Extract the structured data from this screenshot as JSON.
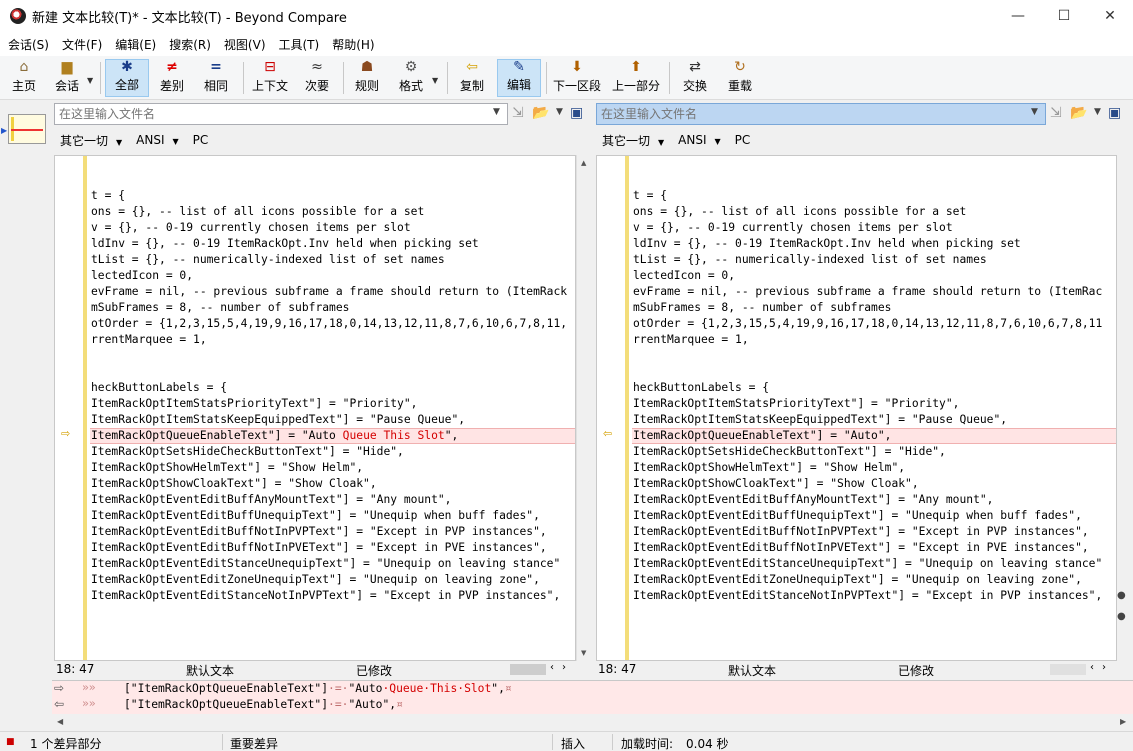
{
  "window": {
    "title": "新建 文本比较(T)* - 文本比较(T) - Beyond Compare",
    "controls": {
      "minimize": "—",
      "maximize": "☐",
      "close": "✕"
    }
  },
  "menu": [
    "会话(S)",
    "文件(F)",
    "编辑(E)",
    "搜索(R)",
    "视图(V)",
    "工具(T)",
    "帮助(H)"
  ],
  "toolbar": {
    "home": "主页",
    "session": "会话",
    "all": "全部",
    "diffs": "差别",
    "same": "相同",
    "context": "上下文",
    "minor": "次要",
    "rules": "规则",
    "format": "格式",
    "copy": "复制",
    "edit": "编辑",
    "next_section": "下一区段",
    "prev_section": "上一部分",
    "swap": "交换",
    "reload": "重载"
  },
  "left": {
    "path_placeholder": "在这里输入文件名",
    "format": {
      "type": "其它一切",
      "encoding": "ANSI",
      "lineend": "PC"
    },
    "lines": [
      "",
      "",
      "t = {",
      "ons = {}, -- list of all icons possible for a set",
      "v = {}, -- 0-19 currently chosen items per slot",
      "ldInv = {}, -- 0-19 ItemRackOpt.Inv held when picking set",
      "tList = {}, -- numerically-indexed list of set names",
      "lectedIcon = 0,",
      "evFrame = nil, -- previous subframe a frame should return to (ItemRack",
      "mSubFrames = 8, -- number of subframes",
      "otOrder = {1,2,3,15,5,4,19,9,16,17,18,0,14,13,12,11,8,7,6,10,6,7,8,11,",
      "rrentMarquee = 1,",
      "",
      "",
      "heckButtonLabels = {",
      "ItemRackOptItemStatsPriorityText\"] = \"Priority\",",
      "ItemRackOptItemStatsKeepEquippedText\"] = \"Pause Queue\",",
      "ItemRackOptQueueEnableText\"] = \"Auto Queue This Slot\",",
      "ItemRackOptSetsHideCheckButtonText\"] = \"Hide\",",
      "ItemRackOptShowHelmText\"] = \"Show Helm\",",
      "ItemRackOptShowCloakText\"] = \"Show Cloak\",",
      "ItemRackOptEventEditBuffAnyMountText\"] = \"Any mount\",",
      "ItemRackOptEventEditBuffUnequipText\"] = \"Unequip when buff fades\",",
      "ItemRackOptEventEditBuffNotInPVPText\"] = \"Except in PVP instances\",",
      "ItemRackOptEventEditBuffNotInPVEText\"] = \"Except in PVE instances\",",
      "ItemRackOptEventEditStanceUnequipText\"] = \"Unequip on leaving stance\"",
      "ItemRackOptEventEditZoneUnequipText\"] = \"Unequip on leaving zone\",",
      "ItemRackOptEventEditStanceNotInPVPText\"] = \"Except in PVP instances\","
    ],
    "diff_line": {
      "prefix": "ItemRackOptQueueEnableText\"] = \"Auto",
      "changed": " Queue This Slot",
      "suffix": "\","
    },
    "status": {
      "pos": "18: 47",
      "type": "默认文本",
      "state": "已修改"
    }
  },
  "right": {
    "path_placeholder": "在这里输入文件名",
    "format": {
      "type": "其它一切",
      "encoding": "ANSI",
      "lineend": "PC"
    },
    "lines": [
      "",
      "",
      "t = {",
      "ons = {}, -- list of all icons possible for a set",
      "v = {}, -- 0-19 currently chosen items per slot",
      "ldInv = {}, -- 0-19 ItemRackOpt.Inv held when picking set",
      "tList = {}, -- numerically-indexed list of set names",
      "lectedIcon = 0,",
      "evFrame = nil, -- previous subframe a frame should return to (ItemRac",
      "mSubFrames = 8, -- number of subframes",
      "otOrder = {1,2,3,15,5,4,19,9,16,17,18,0,14,13,12,11,8,7,6,10,6,7,8,11",
      "rrentMarquee = 1,",
      "",
      "",
      "heckButtonLabels = {",
      "ItemRackOptItemStatsPriorityText\"] = \"Priority\",",
      "ItemRackOptItemStatsKeepEquippedText\"] = \"Pause Queue\",",
      "ItemRackOptQueueEnableText\"] = \"Auto\",",
      "ItemRackOptSetsHideCheckButtonText\"] = \"Hide\",",
      "ItemRackOptShowHelmText\"] = \"Show Helm\",",
      "ItemRackOptShowCloakText\"] = \"Show Cloak\",",
      "ItemRackOptEventEditBuffAnyMountText\"] = \"Any mount\",",
      "ItemRackOptEventEditBuffUnequipText\"] = \"Unequip when buff fades\",",
      "ItemRackOptEventEditBuffNotInPVPText\"] = \"Except in PVP instances\",",
      "ItemRackOptEventEditBuffNotInPVEText\"] = \"Except in PVE instances\",",
      "ItemRackOptEventEditStanceUnequipText\"] = \"Unequip on leaving stance\"",
      "ItemRackOptEventEditZoneUnequipText\"] = \"Unequip on leaving zone\",",
      "ItemRackOptEventEditStanceNotInPVPText\"] = \"Except in PVP instances\","
    ],
    "status": {
      "pos": "18: 47",
      "type": "默认文本",
      "state": "已修改"
    }
  },
  "compare": {
    "top_dots": "»»",
    "top_prefix": "[\"ItemRackOptQueueEnableText\"]",
    "top_eq": "·=·",
    "top_auto": "\"Auto",
    "top_changed": "·Queue·This·Slot",
    "top_end": "\",",
    "top_eol": "¤",
    "bot_dots": "»»",
    "bot_prefix": "[\"ItemRackOptQueueEnableText\"]",
    "bot_eq": "·=·",
    "bot_auto": "\"Auto\",",
    "bot_eol": "¤"
  },
  "statusbar": {
    "diffs": "1 个差异部分",
    "importance": "重要差异",
    "mode": "插入",
    "load_label": "加载时间:",
    "load_value": "0.04 秒"
  },
  "colors": {
    "diff_bg": "#ffe4e4",
    "change_text": "#d40000",
    "change_bar": "#f3dd7a",
    "active_tb": "#cce4f7"
  }
}
